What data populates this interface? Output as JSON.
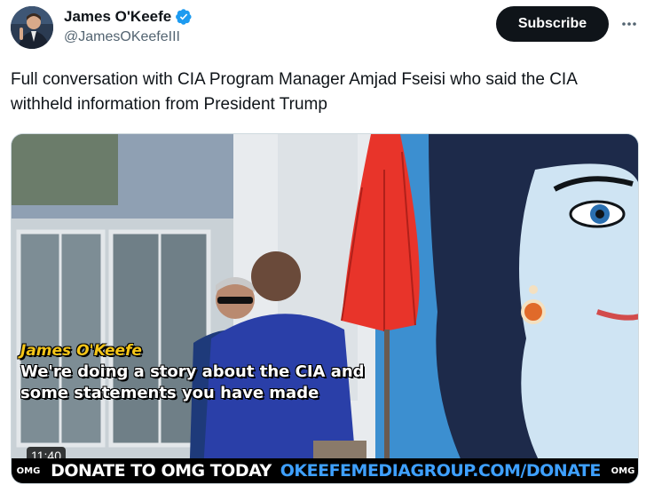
{
  "author": {
    "display_name": "James O'Keefe",
    "handle": "@JamesOKeefeIII",
    "verified_icon": "verified-badge-icon",
    "accent_color": "#1d9bf0"
  },
  "actions": {
    "subscribe_label": "Subscribe",
    "more_icon": "more-horizontal-icon"
  },
  "tweet": {
    "text": "Full conversation with CIA Program Manager Amjad Fseisi who said the CIA withheld information from President Trump"
  },
  "video": {
    "caption_speaker": "James O'Keefe",
    "caption_line_1": "We're doing a story about the CIA and",
    "caption_line_2": "some statements you have made",
    "duration": "11:40",
    "ticker_text": "DONATE TO OMG TODAY",
    "ticker_url": "OKEEFEMEDIAGROUP.COM/DONATE",
    "ticker_logo": "OMG"
  }
}
